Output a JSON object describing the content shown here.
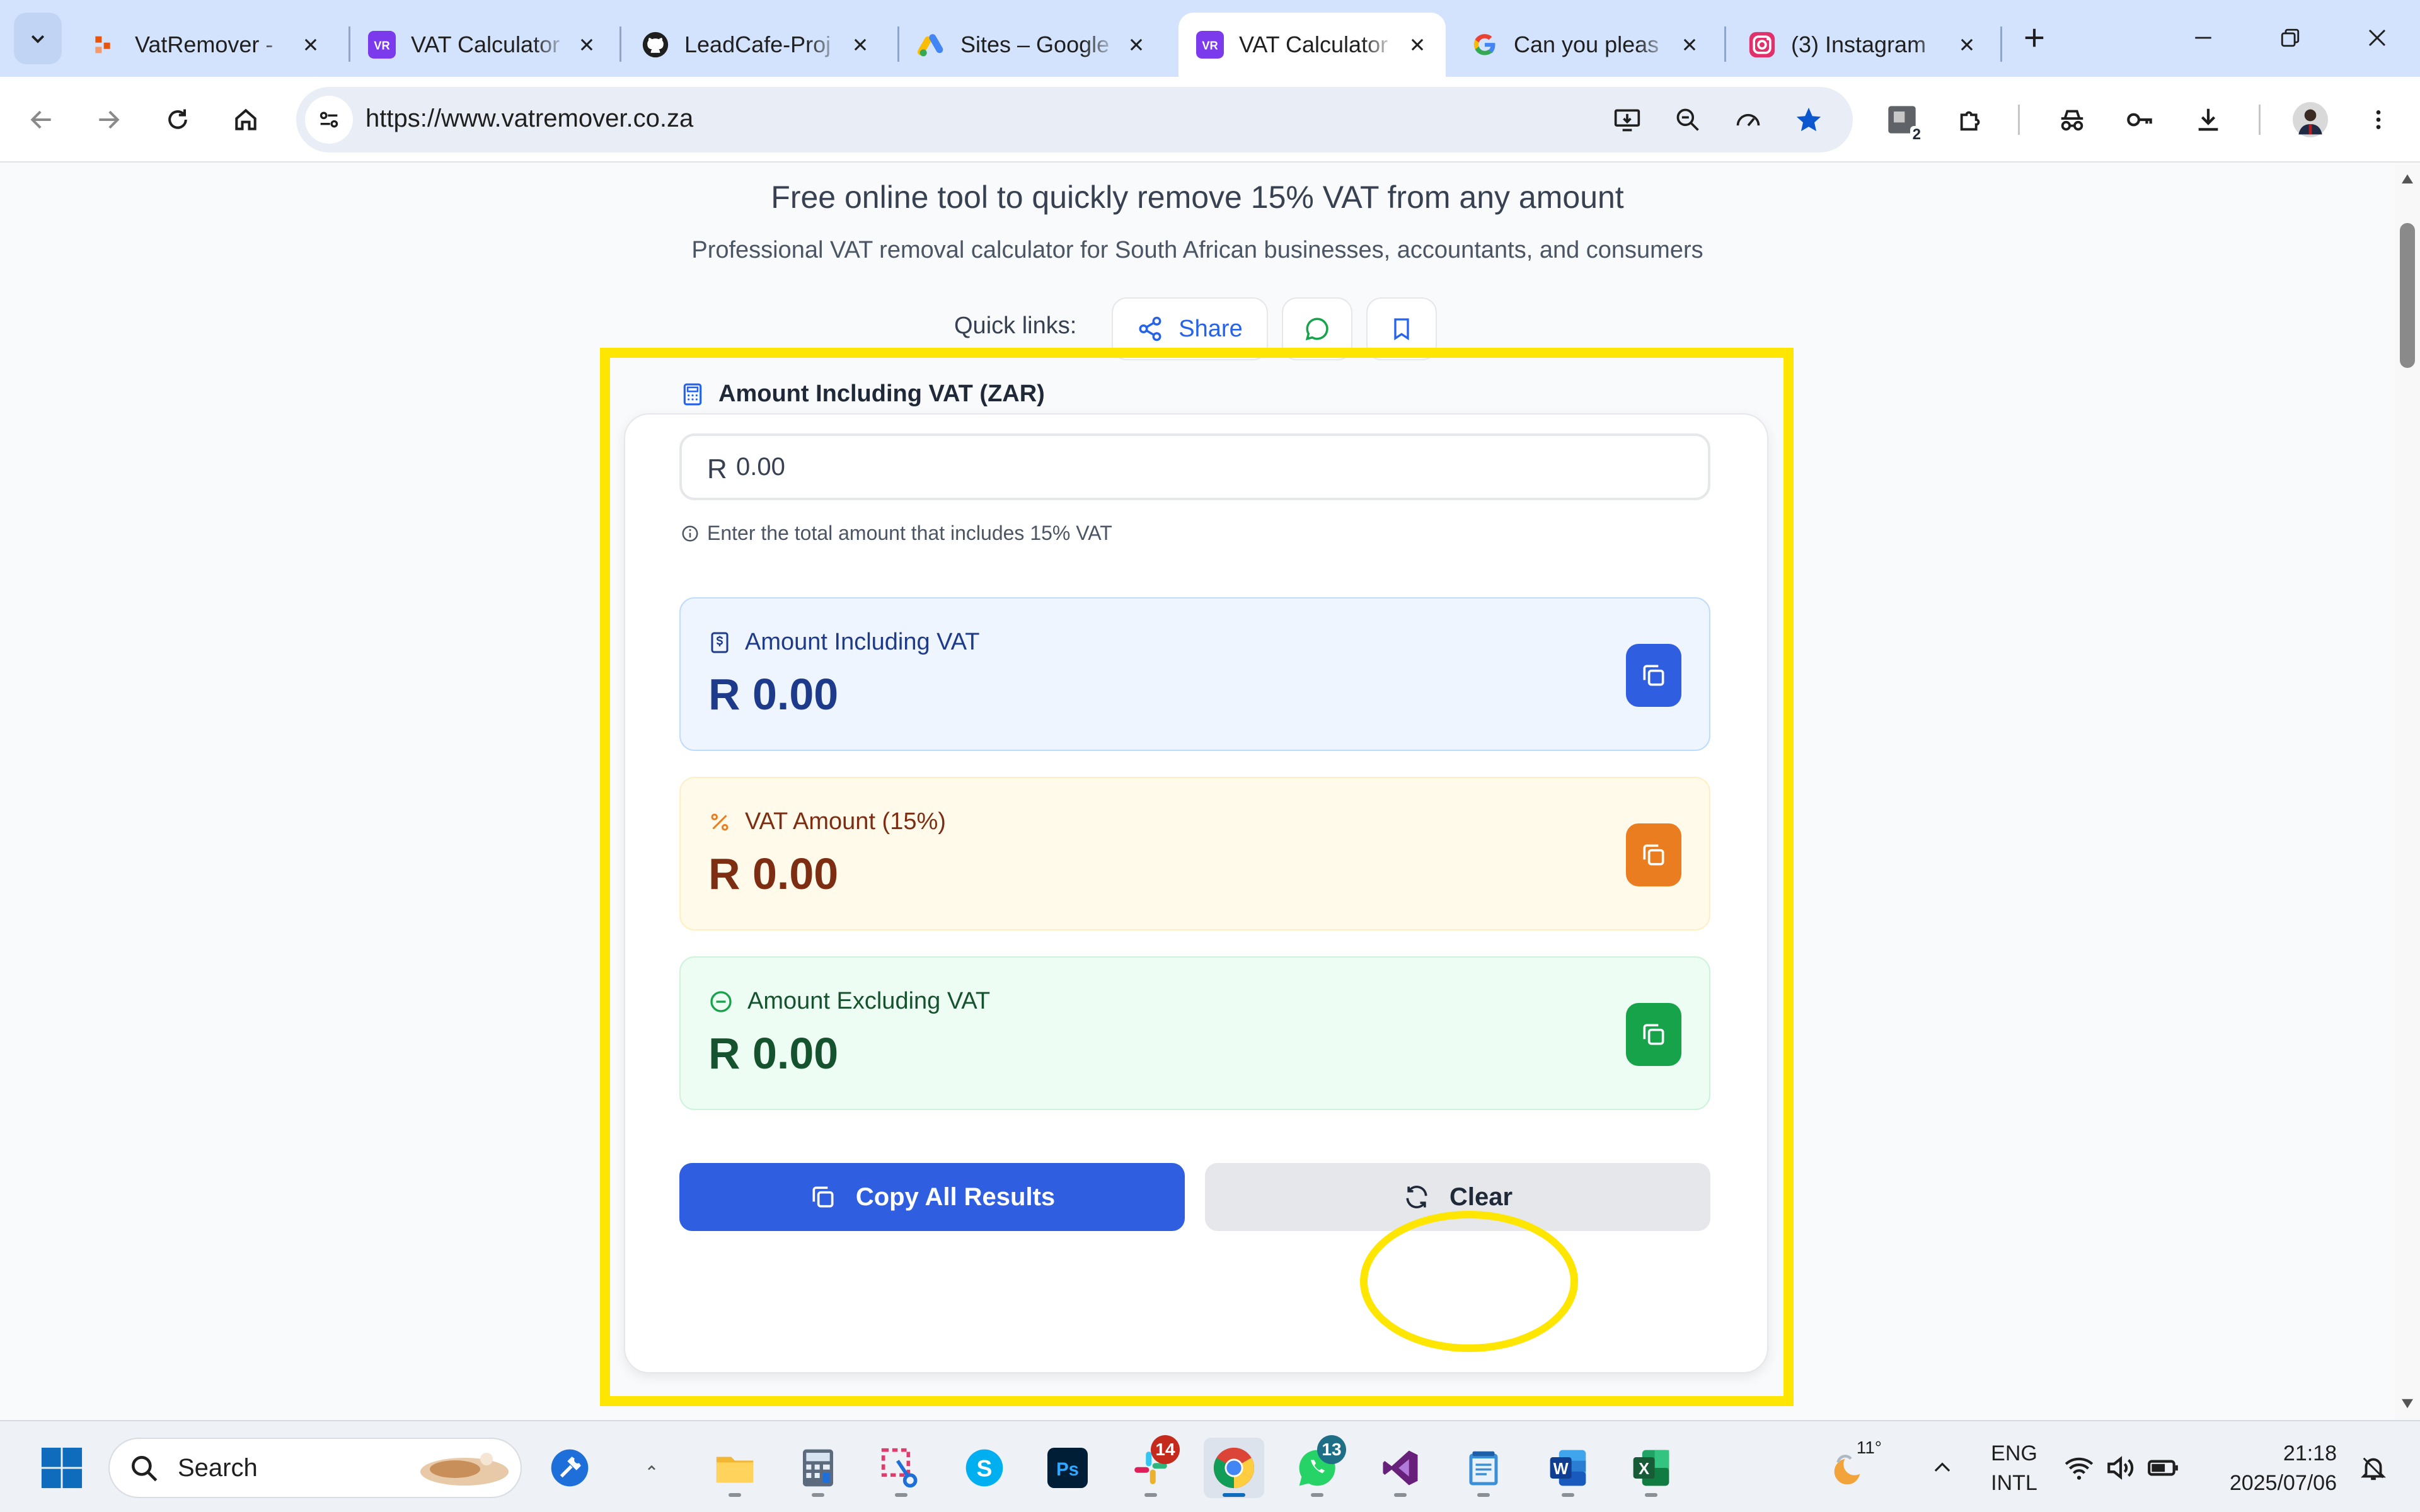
{
  "browser": {
    "tabs": [
      {
        "title": "VatRemover -",
        "icon": "vatremover-favicon",
        "active": false
      },
      {
        "title": "VAT Calculator",
        "icon": "vr-favicon",
        "active": false
      },
      {
        "title": "LeadCafe-Proj",
        "icon": "github-favicon",
        "active": false
      },
      {
        "title": "Sites – Google",
        "icon": "google-ads-favicon",
        "active": false
      },
      {
        "title": "VAT Calculator",
        "icon": "vr-favicon",
        "active": true
      },
      {
        "title": "Can you pleas",
        "icon": "google-favicon",
        "active": false
      },
      {
        "title": "(3) Instagram",
        "icon": "instagram-favicon",
        "active": false
      }
    ],
    "url": "https://www.vatremover.co.za",
    "extensions_badge": "2"
  },
  "page": {
    "subtitle": "Free online tool to quickly remove 15% VAT from any amount",
    "description": "Professional VAT removal calculator for South African businesses, accountants, and consumers",
    "quick_links_label": "Quick links:",
    "share_label": "Share"
  },
  "calculator": {
    "input_label": "Amount Including VAT (ZAR)",
    "currency_prefix": "R",
    "input_placeholder": "0.00",
    "input_value": "",
    "hint": "Enter the total amount that includes 15% VAT",
    "results": [
      {
        "label": "Amount Including VAT",
        "value": "R 0.00",
        "accent": "#2f5ee0"
      },
      {
        "label": "VAT Amount (15%)",
        "value": "R 0.00",
        "accent": "#ea7d1f"
      },
      {
        "label": "Amount Excluding VAT",
        "value": "R 0.00",
        "accent": "#16a34a"
      }
    ],
    "copy_all_label": "Copy All Results",
    "clear_label": "Clear"
  },
  "annotations": {
    "highlight_color": "#ffe600"
  },
  "taskbar": {
    "search_placeholder": "Search",
    "slack_badge": "14",
    "whatsapp_badge": "13",
    "weather_temp": "11°",
    "language_line1": "ENG",
    "language_line2": "INTL",
    "time": "21:18",
    "date": "2025/07/06"
  }
}
